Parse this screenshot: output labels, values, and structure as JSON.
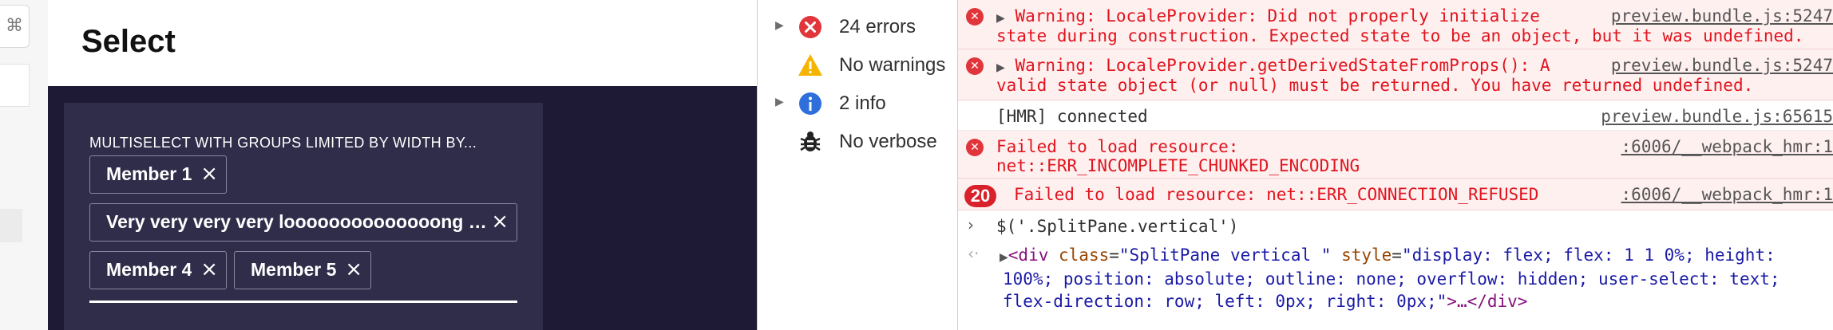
{
  "app": {
    "shortcut_icon": "⌘",
    "title": "Select",
    "field_label": "MULTISELECT WITH GROUPS LIMITED BY WIDTH BY...",
    "chips": [
      {
        "label": "Member 1",
        "remove": "×"
      },
      {
        "label": "Very very very very loooooooooooooong Me...",
        "remove": "×"
      },
      {
        "label": "Member 4",
        "remove": "×"
      },
      {
        "label": "Member 5",
        "remove": "×"
      }
    ]
  },
  "filters": [
    {
      "icon": "error-icon",
      "label": "24 errors",
      "expandable": true
    },
    {
      "icon": "warning-icon",
      "label": "No warnings",
      "expandable": false
    },
    {
      "icon": "info-icon",
      "label": "2 info",
      "expandable": true
    },
    {
      "icon": "bug-icon",
      "label": "No verbose",
      "expandable": false
    }
  ],
  "console": {
    "messages": [
      {
        "level": "error",
        "line1": "Warning: LocaleProvider: Did not properly initialize",
        "line2": "state during construction. Expected state to be an object, but it was undefined.",
        "source": "preview.bundle.js:5247"
      },
      {
        "level": "error",
        "line1": "Warning: LocaleProvider.getDerivedStateFromProps(): A",
        "line2": "valid state object (or null) must be returned. You have returned undefined.",
        "source": "preview.bundle.js:5247"
      },
      {
        "level": "info",
        "line1": "[HMR] connected",
        "source": "preview.bundle.js:65615"
      },
      {
        "level": "error",
        "line1": "Failed to load resource:",
        "line2": "net::ERR_INCOMPLETE_CHUNKED_ENCODING",
        "source": ":6006/__webpack_hmr:1"
      },
      {
        "level": "error",
        "count": "20",
        "line1": "Failed to load resource: net::ERR_CONNECTION_REFUSED",
        "source": ":6006/__webpack_hmr:1"
      }
    ],
    "command": "$('.SplitPane.vertical')",
    "result": {
      "open_tag": "<div",
      "attr1_name": "class",
      "attr1_value": "\"SplitPane  vertical \"",
      "attr2_name": "style",
      "attr2_value_part1": "\"display: flex; flex: 1 1 0%; height:",
      "attr2_value_part2": "100%; position: absolute; outline: none; overflow: hidden; user-select: text;",
      "attr2_value_part3": "flex-direction: row; left: 0px; right: 0px;\"",
      "close": ">…</div>"
    },
    "colors": {
      "error_bg": "#fff0f0",
      "error_text": "#e0141e",
      "link": "#555555"
    }
  }
}
